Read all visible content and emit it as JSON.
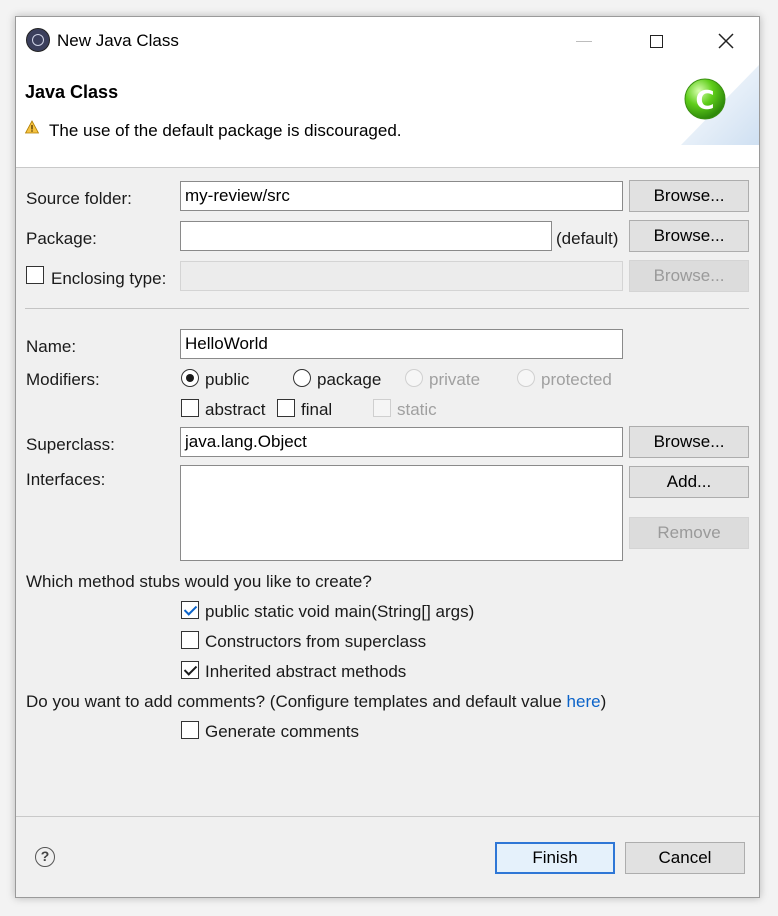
{
  "window": {
    "title": "New Java Class",
    "icon": "eclipse-icon"
  },
  "header": {
    "title": "Java Class",
    "warning_icon": "warning-icon",
    "message": "The use of the default package is discouraged.",
    "banner_icon": "new-class-c-icon"
  },
  "source_folder": {
    "label": "Source folder:",
    "value": "my-review/src",
    "browse": "Browse..."
  },
  "package": {
    "label": "Package:",
    "value": "",
    "suffix": "(default)",
    "browse": "Browse..."
  },
  "enclosing": {
    "label": "Enclosing type:",
    "checked": false,
    "value": "",
    "browse": "Browse..."
  },
  "name": {
    "label": "Name:",
    "value": "HelloWorld"
  },
  "modifiers": {
    "label": "Modifiers:",
    "access": [
      {
        "label": "public",
        "selected": true,
        "enabled": true
      },
      {
        "label": "package",
        "selected": false,
        "enabled": true
      },
      {
        "label": "private",
        "selected": false,
        "enabled": false
      },
      {
        "label": "protected",
        "selected": false,
        "enabled": false
      }
    ],
    "flags": [
      {
        "label": "abstract",
        "checked": false,
        "enabled": true
      },
      {
        "label": "final",
        "checked": false,
        "enabled": true
      },
      {
        "label": "static",
        "checked": false,
        "enabled": false
      }
    ]
  },
  "superclass": {
    "label": "Superclass:",
    "value": "java.lang.Object",
    "browse": "Browse..."
  },
  "interfaces": {
    "label": "Interfaces:",
    "add": "Add...",
    "remove": "Remove"
  },
  "stubs": {
    "question": "Which method stubs would you like to create?",
    "options": [
      {
        "label": "public static void main(String[] args)",
        "checked": true
      },
      {
        "label": "Constructors from superclass",
        "checked": false
      },
      {
        "label": "Inherited abstract methods",
        "checked": true
      }
    ]
  },
  "comments": {
    "question_prefix": "Do you want to add comments? (Configure templates and default value ",
    "link": "here",
    "question_suffix": ")",
    "generate": "Generate comments",
    "generate_checked": false
  },
  "footer": {
    "help": "?",
    "finish": "Finish",
    "cancel": "Cancel"
  },
  "colors": {
    "accent": "#2f77d6",
    "link": "#0b63c9"
  }
}
